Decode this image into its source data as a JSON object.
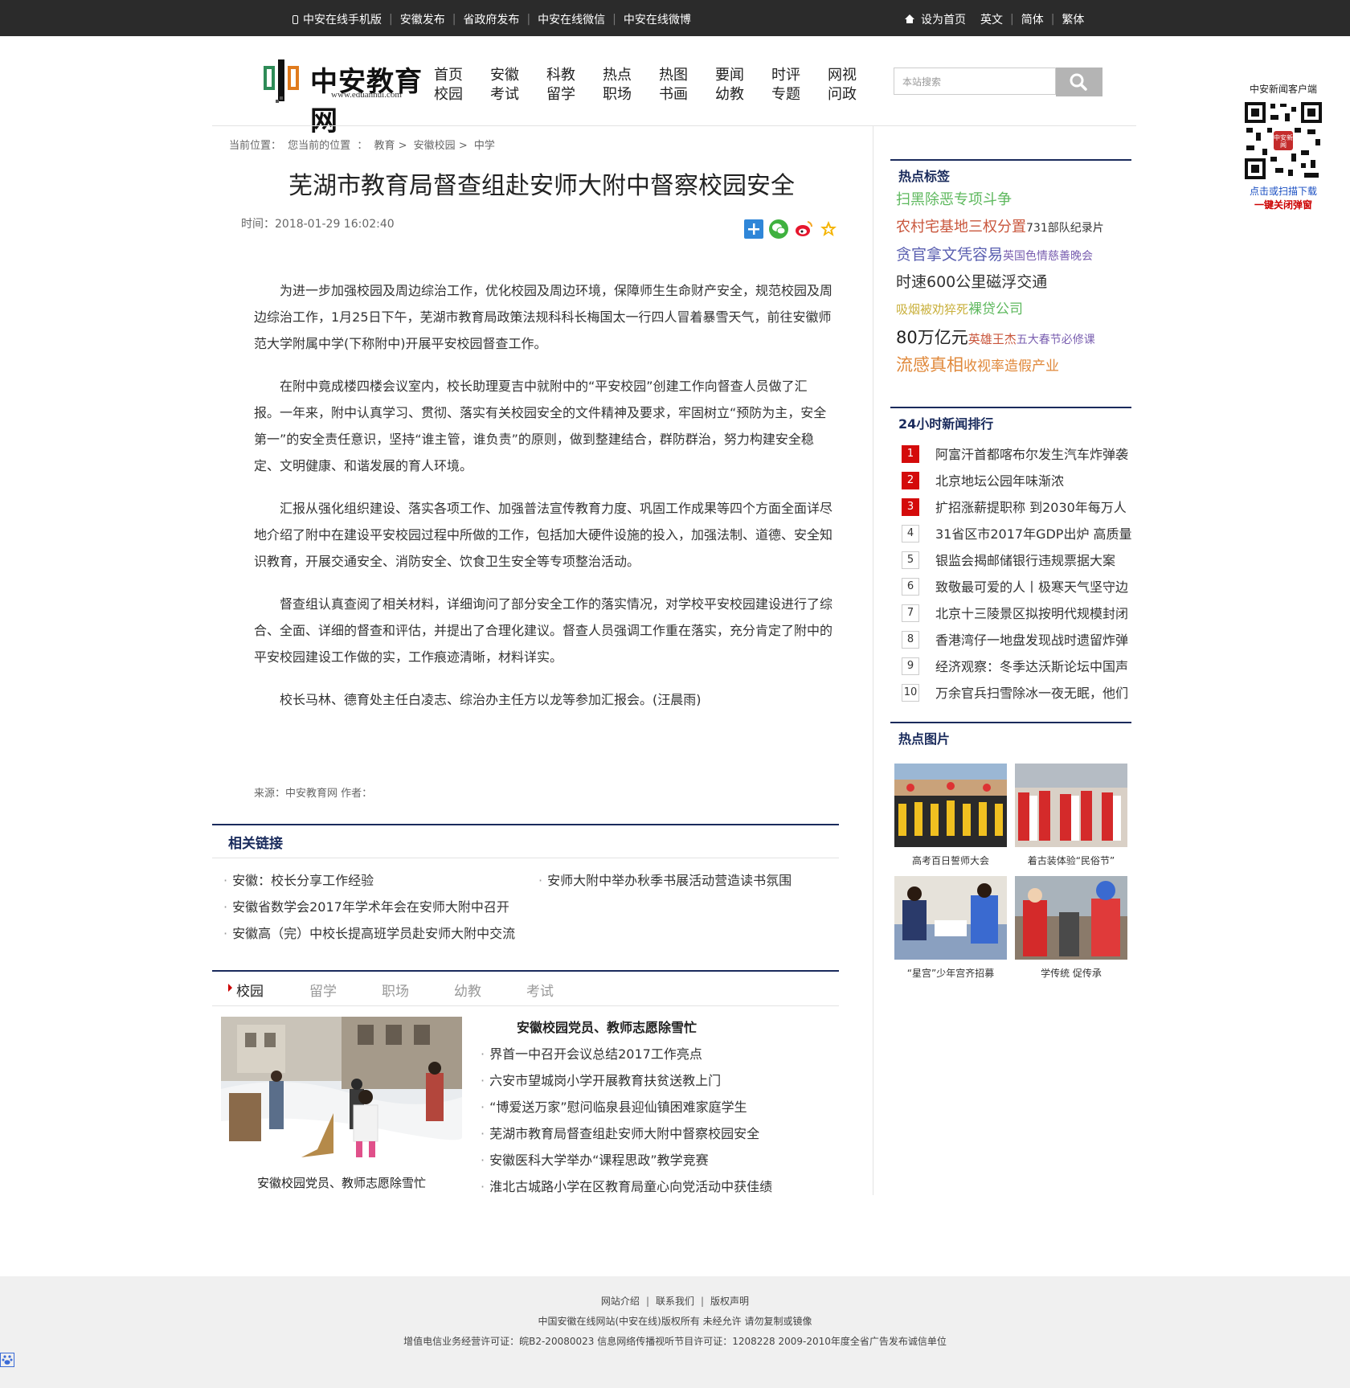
{
  "topbar": {
    "links": [
      "中安在线手机版",
      "安徽发布",
      "省政府发布",
      "中安在线微信",
      "中安在线微博"
    ],
    "right": [
      "设为首页",
      "英文",
      "简体",
      "繁体"
    ]
  },
  "logo": {
    "name": "中安教育网",
    "url": "www.eduanhui.com"
  },
  "nav": [
    [
      "首页",
      "校园"
    ],
    [
      "安徽",
      "考试"
    ],
    [
      "科教",
      "留学"
    ],
    [
      "热点",
      "职场"
    ],
    [
      "热图",
      "书画"
    ],
    [
      "要闻",
      "幼教"
    ],
    [
      "时评",
      "专题"
    ],
    [
      "网视",
      "问政"
    ]
  ],
  "search": {
    "placeholder": "本站搜索"
  },
  "qr": {
    "line1": "中安新闻客户端",
    "line2": "点击或扫描下载",
    "line3": "一键关闭弹窗",
    "badge": "中安新闻"
  },
  "breadcrumb": {
    "label": "当前位置：",
    "items": [
      "您当前的位置",
      "：",
      "教育",
      ">",
      "安徽校园",
      ">",
      "中学"
    ]
  },
  "article": {
    "title": "芜湖市教育局督查组赴安师大附中督察校园安全",
    "time": "时间：2018-01-29 16:02:40",
    "paragraphs": [
      "为进一步加强校园及周边综治工作，优化校园及周边环境，保障师生生命财产安全，规范校园及周边综治工作，1月25日下午，芜湖市教育局政策法规科科长梅国太一行四人冒着暴雪天气，前往安徽师范大学附属中学(下称附中)开展平安校园督查工作。",
      "在附中竟成楼四楼会议室内，校长助理夏吉中就附中的“平安校园”创建工作向督查人员做了汇报。一年来，附中认真学习、贯彻、落实有关校园安全的文件精神及要求，牢固树立“预防为主，安全第一”的安全责任意识，坚持“谁主管，谁负责”的原则，做到整建结合，群防群治，努力构建安全稳定、文明健康、和谐发展的育人环境。",
      "汇报从强化组织建设、落实各项工作、加强普法宣传教育力度、巩固工作成果等四个方面全面详尽地介绍了附中在建设平安校园过程中所做的工作，包括加大硬件设施的投入，加强法制、道德、安全知识教育，开展交通安全、消防安全、饮食卫生安全等专项整治活动。",
      "督查组认真查阅了相关材料，详细询问了部分安全工作的落实情况，对学校平安校园建设进行了综合、全面、详细的督查和评估，并提出了合理化建议。督查人员强调工作重在落实，充分肯定了附中的平安校园建设工作做的实，工作痕迹清晰，材料详实。",
      "校长马林、德育处主任白凌志、综治办主任方以龙等参加汇报会。(汪晨雨)"
    ],
    "source": "来源：中安教育网   作者："
  },
  "related": {
    "heading": "相关链接",
    "items": [
      "安徽：校长分享工作经验",
      "安师大附中举办秋季书展活动营造读书氛围",
      "安徽省数学会2017年学术年会在安师大附中召开",
      "安徽高（完）中校长提高班学员赴安师大附中交流"
    ]
  },
  "tabs": [
    "校园",
    "留学",
    "职场",
    "幼教",
    "考试"
  ],
  "feature": {
    "caption": "安徽校园党员、教师志愿除雪忙",
    "title": "安徽校园党员、教师志愿除雪忙",
    "list": [
      "界首一中召开会议总结2017工作亮点",
      "六安市望城岗小学开展教育扶贫送教上门",
      "“博爱送万家”慰问临泉县迎仙镇困难家庭学生",
      "芜湖市教育局督查组赴安师大附中督察校园安全",
      "安徽医科大学举办“课程思政”教学竞赛",
      "淮北古城路小学在区教育局童心向党活动中获佳绩"
    ]
  },
  "sidebar": {
    "tags_heading": "热点标签",
    "tag_rows": [
      [
        {
          "t": "扫黑除恶专项斗争",
          "c": "#5db85d",
          "s": 18
        }
      ],
      [
        {
          "t": "农村宅基地三权分置",
          "c": "#c9563c",
          "s": 18
        },
        {
          "t": "731部队纪录片",
          "c": "#333333",
          "s": 14
        }
      ],
      [
        {
          "t": "贪官拿文凭容易",
          "c": "#5a5fb0",
          "s": 19
        },
        {
          "t": "英国色情慈善晚会",
          "c": "#7a5fb0",
          "s": 14
        }
      ],
      [
        {
          "t": "时速600公里磁浮交通",
          "c": "#333333",
          "s": 19
        }
      ],
      [
        {
          "t": "吸烟被劝猝死",
          "c": "#c9b03c",
          "s": 15
        },
        {
          "t": "裸贷公司",
          "c": "#5db85d",
          "s": 17
        }
      ],
      [
        {
          "t": "80万亿元",
          "c": "#222222",
          "s": 21
        },
        {
          "t": "英雄王杰",
          "c": "#c9563c",
          "s": 15
        },
        {
          "t": "五大春节必修课",
          "c": "#7a5fb0",
          "s": 14
        }
      ],
      [
        {
          "t": "流感真相",
          "c": "#e0883a",
          "s": 21
        },
        {
          "t": "收视率造假产业",
          "c": "#e0883a",
          "s": 17
        }
      ]
    ],
    "rank_heading": "24小时新闻排行",
    "rank": [
      {
        "n": "1",
        "t": "阿富汗首都喀布尔发生汽车炸弹袭"
      },
      {
        "n": "2",
        "t": "北京地坛公园年味渐浓"
      },
      {
        "n": "3",
        "t": "扩招涨薪提职称 到2030年每万人"
      },
      {
        "n": "4",
        "t": "31省区市2017年GDP出炉 高质量"
      },
      {
        "n": "5",
        "t": "银监会揭邮储银行违规票据大案"
      },
      {
        "n": "6",
        "t": "致敬最可爱的人丨极寒天气坚守边"
      },
      {
        "n": "7",
        "t": "北京十三陵景区拟按明代规模封闭"
      },
      {
        "n": "8",
        "t": "香港湾仔一地盘发现战时遗留炸弹"
      },
      {
        "n": "9",
        "t": "经济观察：冬季达沃斯论坛中国声"
      },
      {
        "n": "10",
        "t": "万余官兵扫雪除冰一夜无眠，他们"
      }
    ],
    "pics_heading": "热点图片",
    "pics": [
      "高考百日誓师大会",
      "着古装体验“民俗节”",
      "“星宫”少年宫齐招募",
      "学传统 促传承"
    ]
  },
  "footer": {
    "links": [
      "网站介绍",
      "联系我们",
      "版权声明"
    ],
    "line2": "中国安徽在线网站(中安在线)版权所有 未经允许 请勿复制或镜像",
    "line3": "增值电信业务经营许可证：皖B2-20080023 信息网络传播视听节目许可证：1208228   2009-2010年度全省广告发布诚信单位"
  }
}
